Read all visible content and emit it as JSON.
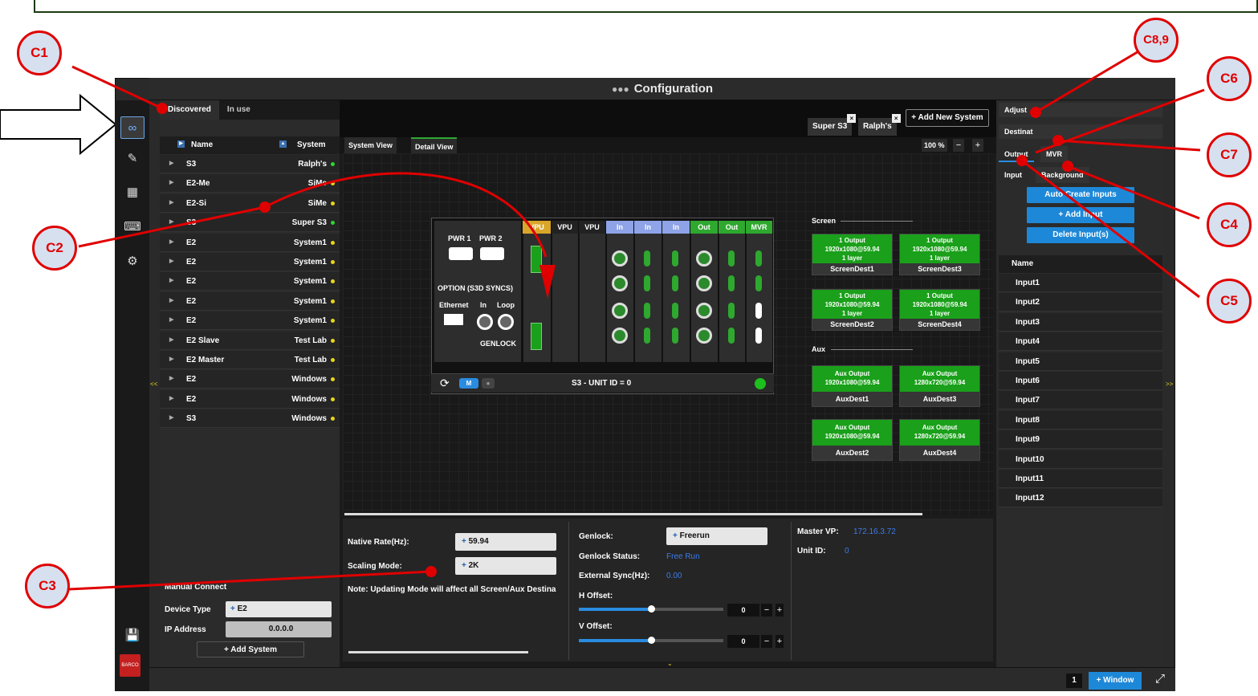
{
  "window": {
    "title": "Configuration"
  },
  "left_tabs": [
    "Discovered",
    "In use"
  ],
  "system_list": {
    "header_name": "Name",
    "header_system": "System",
    "rows": [
      {
        "name": "S3",
        "system": "Ralph's",
        "dot_color": "#2fd52f"
      },
      {
        "name": "E2-Me",
        "system": "SiMe",
        "dot_color": "#e8d51c"
      },
      {
        "name": "E2-Si",
        "system": "SiMe",
        "dot_color": "#e8d51c"
      },
      {
        "name": "S3",
        "system": "Super S3",
        "dot_color": "#2fd52f"
      },
      {
        "name": "E2",
        "system": "System1",
        "dot_color": "#e8d51c"
      },
      {
        "name": "E2",
        "system": "System1",
        "dot_color": "#e8d51c"
      },
      {
        "name": "E2",
        "system": "System1",
        "dot_color": "#e8d51c"
      },
      {
        "name": "E2",
        "system": "System1",
        "dot_color": "#e8d51c"
      },
      {
        "name": "E2",
        "system": "System1",
        "dot_color": "#e8d51c"
      },
      {
        "name": "E2 Slave",
        "system": "Test Lab",
        "dot_color": "#e8d51c"
      },
      {
        "name": "E2 Master",
        "system": "Test Lab",
        "dot_color": "#e8d51c"
      },
      {
        "name": "E2",
        "system": "Windows",
        "dot_color": "#e8d51c"
      },
      {
        "name": "E2",
        "system": "Windows",
        "dot_color": "#e8d51c"
      },
      {
        "name": "S3",
        "system": "Windows",
        "dot_color": "#e8d51c"
      }
    ]
  },
  "manual_connect": {
    "title": "Manual Connect",
    "device_type_label": "Device Type",
    "device_type_value": "E2",
    "ip_label": "IP Address",
    "ip_value": "0.0.0.0",
    "add_system_label": "+ Add System"
  },
  "system_tabs": [
    "Super S3",
    "Ralph's"
  ],
  "add_new_system_label": "+ Add New System",
  "view_tabs": [
    "System View",
    "Detail View"
  ],
  "zoom_label": "100 %",
  "unit": {
    "slot_headers": [
      "VPU",
      "VPU",
      "VPU",
      "In",
      "In",
      "In",
      "Out",
      "Out",
      "MVR"
    ],
    "pwr1": "PWR 1",
    "pwr2": "PWR 2",
    "option_label": "OPTION (S3D SYNCS)",
    "ethernet": "Ethernet",
    "sync_in": "In",
    "sync_loop": "Loop",
    "genlock": "GENLOCK",
    "mode_badge": "M",
    "unit_label": "S3 - UNIT ID = 0"
  },
  "screen_section_label": "Screen",
  "aux_section_label": "Aux",
  "screen_dests": [
    {
      "l1": "1 Output",
      "l2": "1920x1080@59.94",
      "l3": "1 layer",
      "name": "ScreenDest1"
    },
    {
      "l1": "1 Output",
      "l2": "1920x1080@59.94",
      "l3": "1 layer",
      "name": "ScreenDest3"
    },
    {
      "l1": "1 Output",
      "l2": "1920x1080@59.94",
      "l3": "1 layer",
      "name": "ScreenDest2"
    },
    {
      "l1": "1 Output",
      "l2": "1920x1080@59.94",
      "l3": "1 layer",
      "name": "ScreenDest4"
    }
  ],
  "aux_dests": [
    {
      "l1": "Aux Output",
      "l2": "1920x1080@59.94",
      "name": "AuxDest1"
    },
    {
      "l1": "Aux Output",
      "l2": "1280x720@59.94",
      "name": "AuxDest3"
    },
    {
      "l1": "Aux Output",
      "l2": "1920x1080@59.94",
      "name": "AuxDest2"
    },
    {
      "l1": "Aux Output",
      "l2": "1280x720@59.94",
      "name": "AuxDest4"
    }
  ],
  "props": {
    "native_rate_label": "Native Rate(Hz):",
    "native_rate_value": "59.94",
    "scaling_mode_label": "Scaling Mode:",
    "scaling_mode_value": "2K",
    "note": "Note: Updating Mode will affect all Screen/Aux Destina",
    "genlock_label": "Genlock:",
    "genlock_value": "Freerun",
    "genlock_status_label": "Genlock Status:",
    "genlock_status_value": "Free Run",
    "ext_sync_label": "External Sync(Hz):",
    "ext_sync_value": "0.00",
    "h_offset_label": "H Offset:",
    "h_offset_value": "0",
    "v_offset_label": "V Offset:",
    "v_offset_value": "0",
    "master_vp_label": "Master VP:",
    "master_vp_value": "172.16.3.72",
    "unit_id_label": "Unit ID:",
    "unit_id_value": "0"
  },
  "right_panel": {
    "adjust": "Adjust",
    "destination": "Destinat",
    "tabs_top": [
      "Output",
      "MVR"
    ],
    "tabs_sub": [
      "Input",
      "Background"
    ],
    "btn_auto": "Auto Create Inputs",
    "btn_add": "+ Add Input",
    "btn_delete": "Delete Input(s)",
    "list_header": "Name",
    "inputs": [
      "Input1",
      "Input2",
      "Input3",
      "Input4",
      "Input5",
      "Input6",
      "Input7",
      "Input8",
      "Input9",
      "Input10",
      "Input11",
      "Input12"
    ]
  },
  "bottom_bar": {
    "page": "1",
    "window_btn": "+ Window"
  },
  "callouts": [
    "C1",
    "C2",
    "C3",
    "C4",
    "C5",
    "C6",
    "C7",
    "C8,9"
  ],
  "colors": {
    "accent": "#1e88d8",
    "callout_red": "#e00000",
    "dest_green": "#1aa01a"
  },
  "icons": [
    "configuration-icon",
    "edit-icon",
    "layout-grid-icon",
    "keyboard-icon",
    "gear-icon",
    "save-icon",
    "barco-logo"
  ]
}
